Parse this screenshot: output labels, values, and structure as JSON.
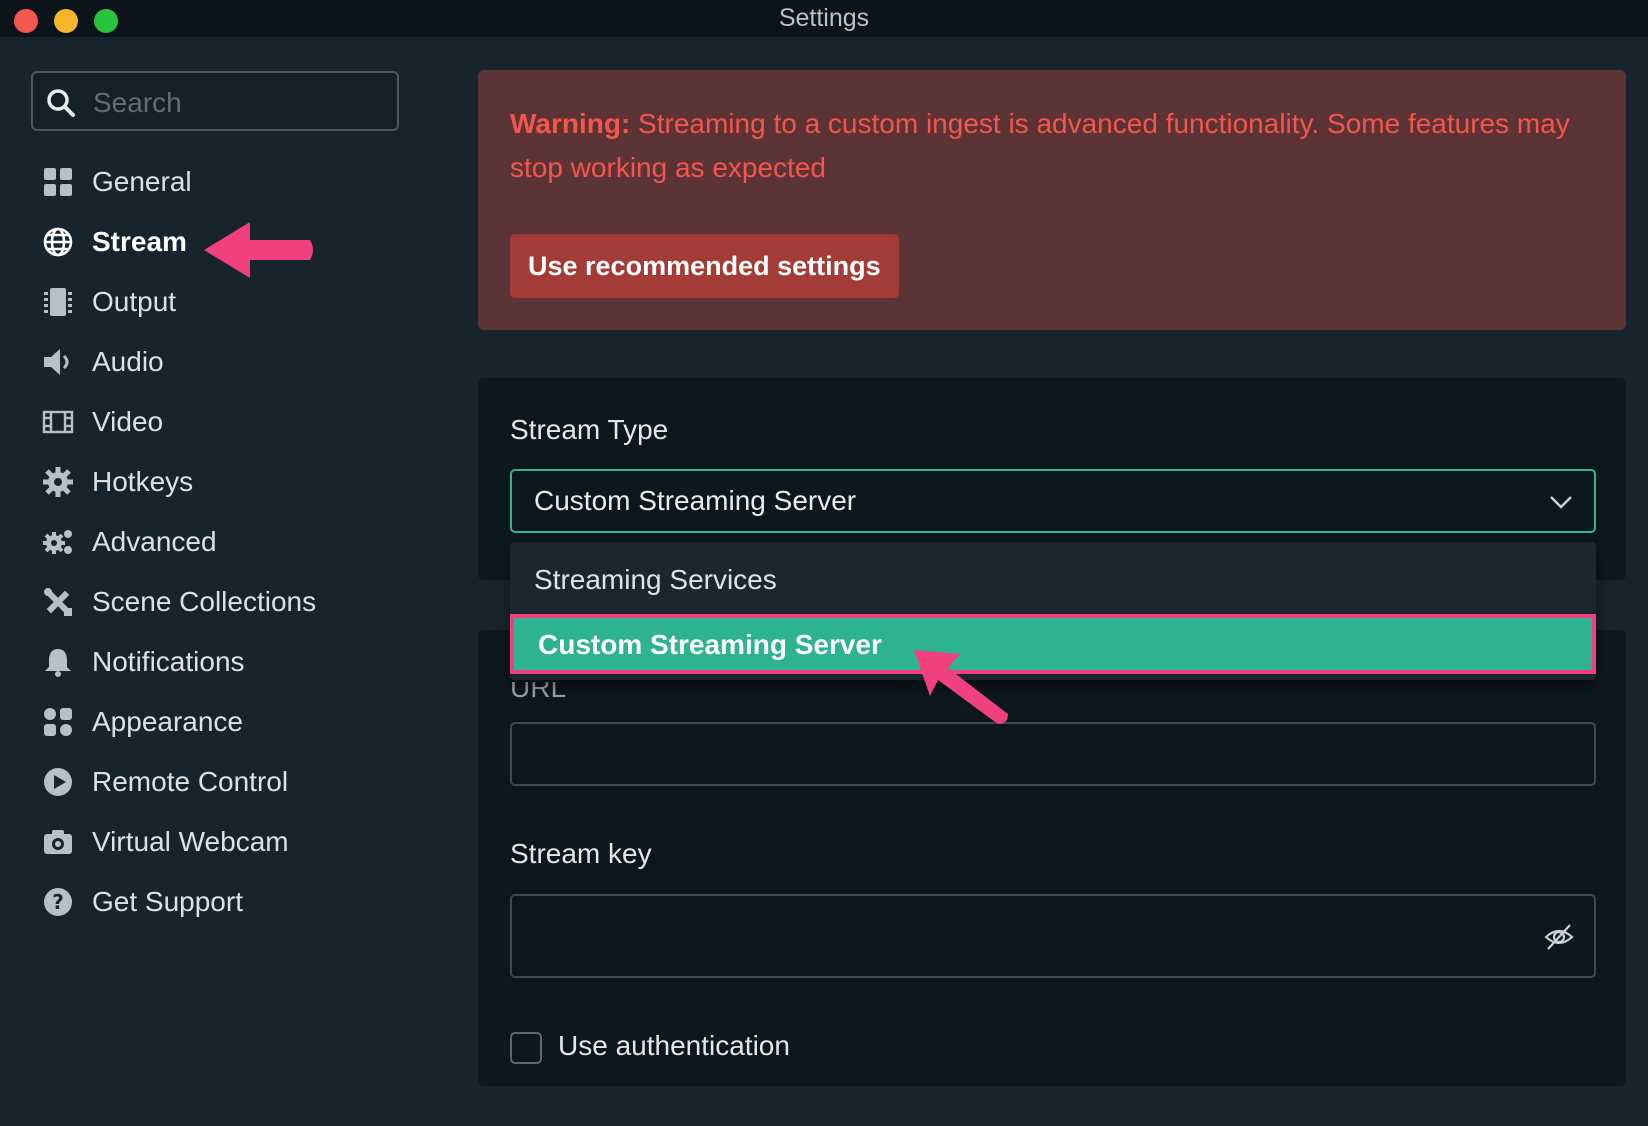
{
  "window": {
    "title": "Settings"
  },
  "sidebar": {
    "search_placeholder": "Search",
    "items": [
      {
        "label": "General",
        "icon": "grid-icon"
      },
      {
        "label": "Stream",
        "icon": "globe-icon",
        "active": true
      },
      {
        "label": "Output",
        "icon": "output-icon"
      },
      {
        "label": "Audio",
        "icon": "speaker-icon"
      },
      {
        "label": "Video",
        "icon": "film-icon"
      },
      {
        "label": "Hotkeys",
        "icon": "gear-icon"
      },
      {
        "label": "Advanced",
        "icon": "gears-icon"
      },
      {
        "label": "Scene Collections",
        "icon": "tools-icon"
      },
      {
        "label": "Notifications",
        "icon": "bell-icon"
      },
      {
        "label": "Appearance",
        "icon": "shapes-icon"
      },
      {
        "label": "Remote Control",
        "icon": "play-icon"
      },
      {
        "label": "Virtual Webcam",
        "icon": "camera-icon"
      },
      {
        "label": "Get Support",
        "icon": "help-icon"
      }
    ]
  },
  "warning": {
    "prefix": "Warning:",
    "message": " Streaming to a custom ingest is advanced functionality. Some features may stop working as expected",
    "button_label": "Use recommended settings"
  },
  "stream_type": {
    "label": "Stream Type",
    "selected": "Custom Streaming Server",
    "options": [
      "Streaming Services",
      "Custom Streaming Server"
    ]
  },
  "server": {
    "url_label": "URL",
    "url_value": "",
    "key_label": "Stream key",
    "key_value": "",
    "auth_label": "Use authentication"
  },
  "colors": {
    "accent": "#2db390",
    "warning_bg": "#5c3435",
    "warning_text": "#f5554c",
    "annotation": "#f0407d"
  }
}
